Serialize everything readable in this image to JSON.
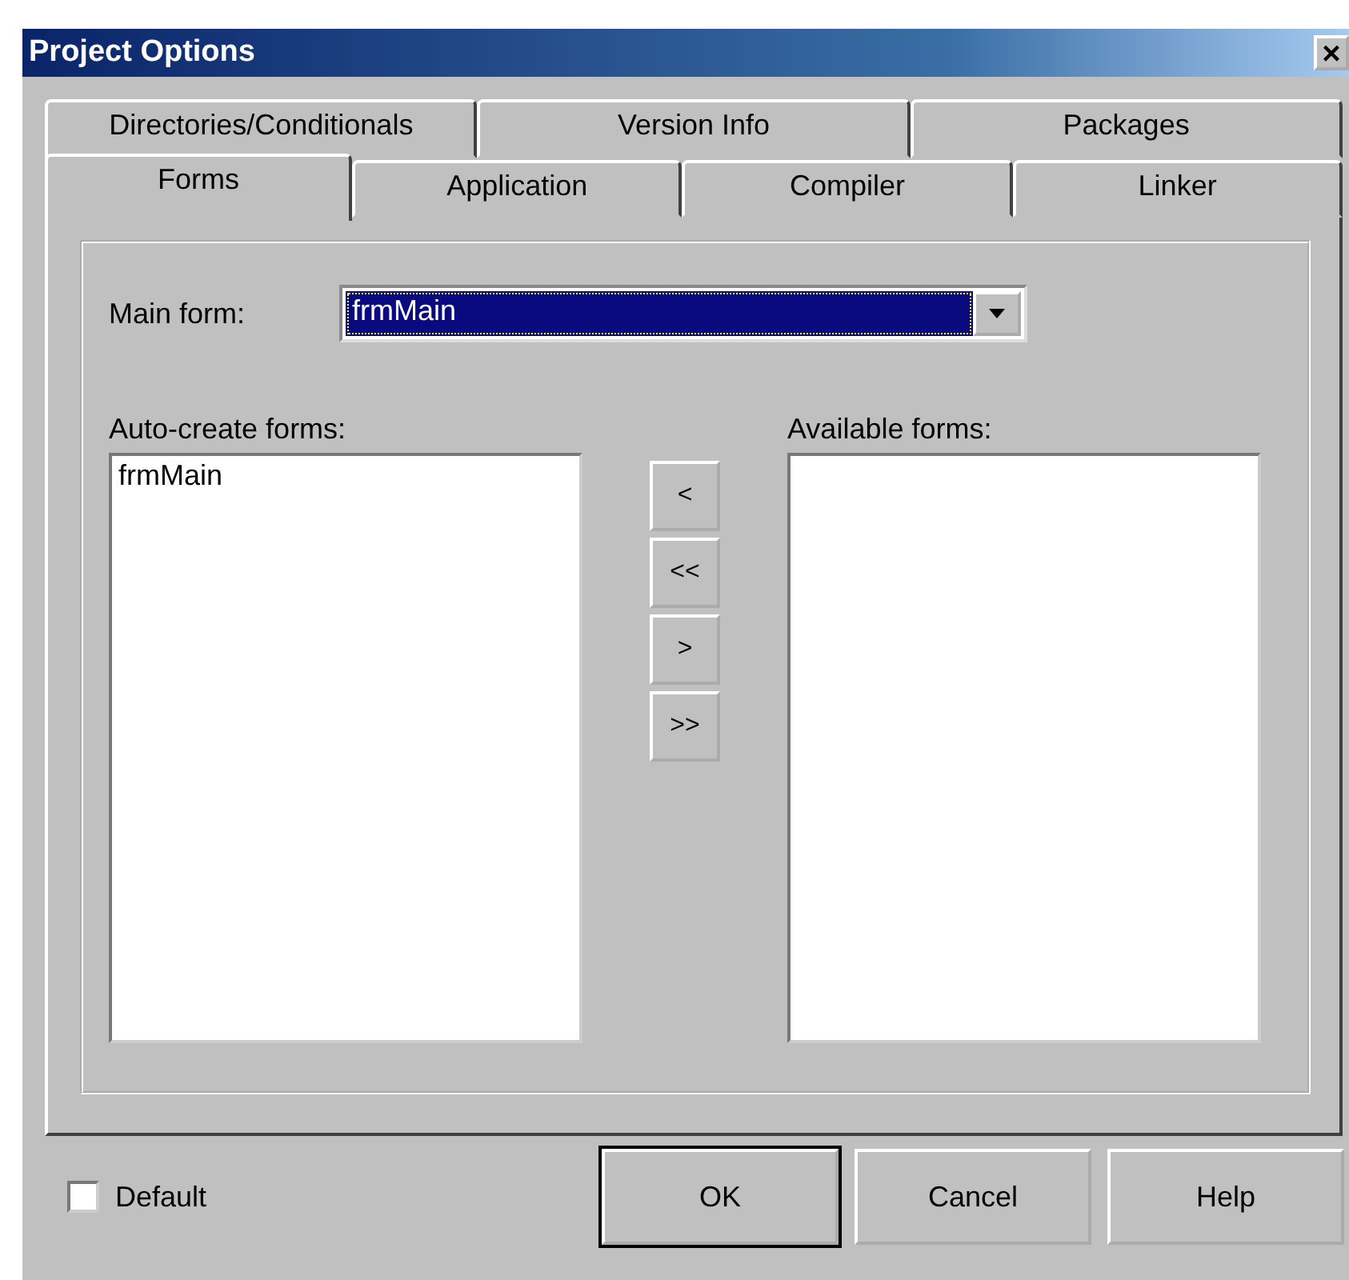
{
  "window": {
    "title": "Project Options",
    "close": "×"
  },
  "tab_rows": [
    [
      {
        "label": "Directories/Conditionals",
        "selected": false
      },
      {
        "label": "Version Info",
        "selected": false
      },
      {
        "label": "Packages",
        "selected": false
      }
    ],
    [
      {
        "label": "Forms",
        "selected": true
      },
      {
        "label": "Application",
        "selected": false
      },
      {
        "label": "Compiler",
        "selected": false
      },
      {
        "label": "Linker",
        "selected": false
      }
    ]
  ],
  "main_form": {
    "label": "Main form:",
    "value": "frmMain"
  },
  "auto_create": {
    "label": "Auto-create forms:",
    "items": [
      {
        "label": "frmMain",
        "selected": false
      }
    ]
  },
  "move_buttons": [
    "<",
    "<<",
    ">",
    ">>"
  ],
  "available": {
    "label": "Available forms:"
  },
  "default_checkbox": {
    "label": "Default",
    "checked": false
  },
  "buttons": [
    {
      "label": "OK",
      "default": true
    },
    {
      "label": "Cancel",
      "default": false
    },
    {
      "label": "Help",
      "default": false
    }
  ]
}
